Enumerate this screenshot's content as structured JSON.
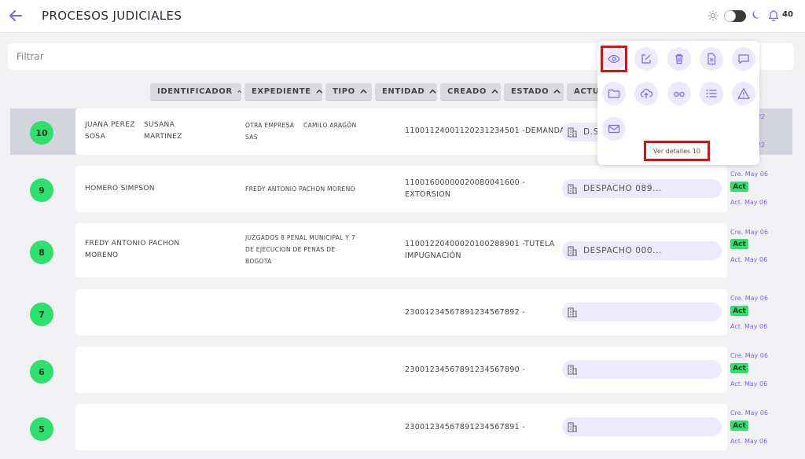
{
  "header": {
    "title": "PROCESOS JUDICIALES",
    "notification_count": "40"
  },
  "filter": {
    "placeholder": "Filtrar"
  },
  "columns": [
    "IDENTIFICADOR",
    "EXPEDIENTE",
    "TIPO",
    "ENTIDAD",
    "CREADO",
    "ESTADO",
    "ACTUA"
  ],
  "rows": [
    {
      "num": "10",
      "selected": true,
      "parties_left": [
        "JUANA PEREZ",
        "SOSA"
      ],
      "parties_right": [
        "SUSANA",
        "MARTINEZ"
      ],
      "org_left": [
        "OTRA EMPRESA",
        "SAS"
      ],
      "org_right": [
        "CAMILO ARAGÓN"
      ],
      "expediente": [
        "11001124001120231234501 -DEMANDA"
      ],
      "entidad": "D.S...",
      "cre": "22",
      "act": "22"
    },
    {
      "num": "9",
      "parties": [
        "HOMERO SIMPSON"
      ],
      "org": [
        "FREDY ANTONIO PACHON MORENO"
      ],
      "expediente": [
        "11001600000020080041600 -",
        "EXTORSION"
      ],
      "entidad": "DESPACHO 089...",
      "cre": "Cre. May 06",
      "status": "Act",
      "act": "Act. May 06"
    },
    {
      "num": "8",
      "parties": [
        "FREDY ANTONIO PACHON",
        "MORENO"
      ],
      "org": [
        "JUZGADOS 8 PENAL MUNICIPAL Y 7",
        "DE EJECUCION DE PENAS DE",
        "BOGOTA"
      ],
      "expediente": [
        "11001220400020100288901 -TUTELA",
        "IMPUGNACIÓN"
      ],
      "entidad": "DESPACHO 000...",
      "cre": "Cre. May 06",
      "status": "Act",
      "act": "Act. May 06"
    },
    {
      "num": "7",
      "parties": [],
      "org": [],
      "expediente": [
        "23001234567891234567892 -"
      ],
      "entidad": "",
      "cre": "Cre. May 06",
      "status": "Act",
      "act": "Act. May 06"
    },
    {
      "num": "6",
      "parties": [],
      "org": [],
      "expediente": [
        "23001234567891234567890 -"
      ],
      "entidad": "",
      "cre": "Cre. May 06",
      "status": "Act",
      "act": "Act. May 06"
    },
    {
      "num": "5",
      "parties": [],
      "org": [],
      "expediente": [
        "23001234567891234567891 -"
      ],
      "entidad": "",
      "cre": "Cre. May 06",
      "status": "Act",
      "act": "Act. May 06"
    }
  ],
  "popup": {
    "actions": [
      "eye-icon",
      "edit-icon",
      "trash-icon",
      "document-icon",
      "comment-icon",
      "folder-icon",
      "cloud-upload-icon",
      "glasses-icon",
      "list-icon",
      "warning-icon",
      "mail-icon"
    ],
    "detail_label": "Ver detalles 10"
  },
  "colors": {
    "accent": "#7b61ff",
    "badge_green": "#2ee06d",
    "highlight_red": "#e01010"
  }
}
